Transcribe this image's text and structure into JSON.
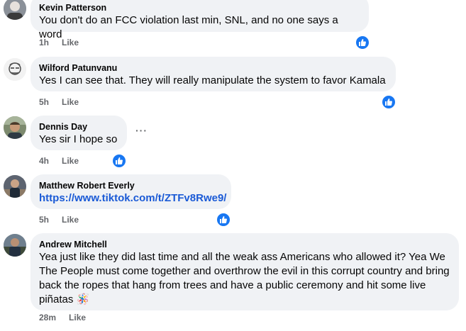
{
  "comments": [
    {
      "author": "Kevin Patterson",
      "text": "You don't do an FCC violation last min, SNL, and no one says a word",
      "time": "1h",
      "like_label": "Like",
      "reaction_icon": "like-reaction-icon"
    },
    {
      "author": "Wilford Patunvanu",
      "text": "Yes I can see that. They will really manipulate the system to favor Kamala",
      "time": "5h",
      "like_label": "Like",
      "reaction_icon": "like-reaction-icon"
    },
    {
      "author": "Dennis Day",
      "text": "Yes sir I hope so",
      "time": "4h",
      "like_label": "Like",
      "more_label": "···",
      "reaction_icon": "like-reaction-icon"
    },
    {
      "author": "Matthew Robert Everly",
      "text": "https://www.tiktok.com/t/ZTFv8Rwe9/",
      "time": "5h",
      "like_label": "Like",
      "reaction_icon": "like-reaction-icon"
    },
    {
      "author": "Andrew Mitchell",
      "text": "Yea just like they did last time and all the weak ass Americans who allowed it? Yea We The People must come together and overthrow the evil in this corrupt country and bring back the ropes that hang from trees and have a public ceremony and hit some live piñatas 🪅",
      "time": "28m",
      "like_label": "Like"
    }
  ],
  "colors": {
    "bubble_bg": "#f0f2f5",
    "meta_text": "#65676b",
    "link": "#1a5ad6",
    "reaction_blue": "#1877f2"
  }
}
